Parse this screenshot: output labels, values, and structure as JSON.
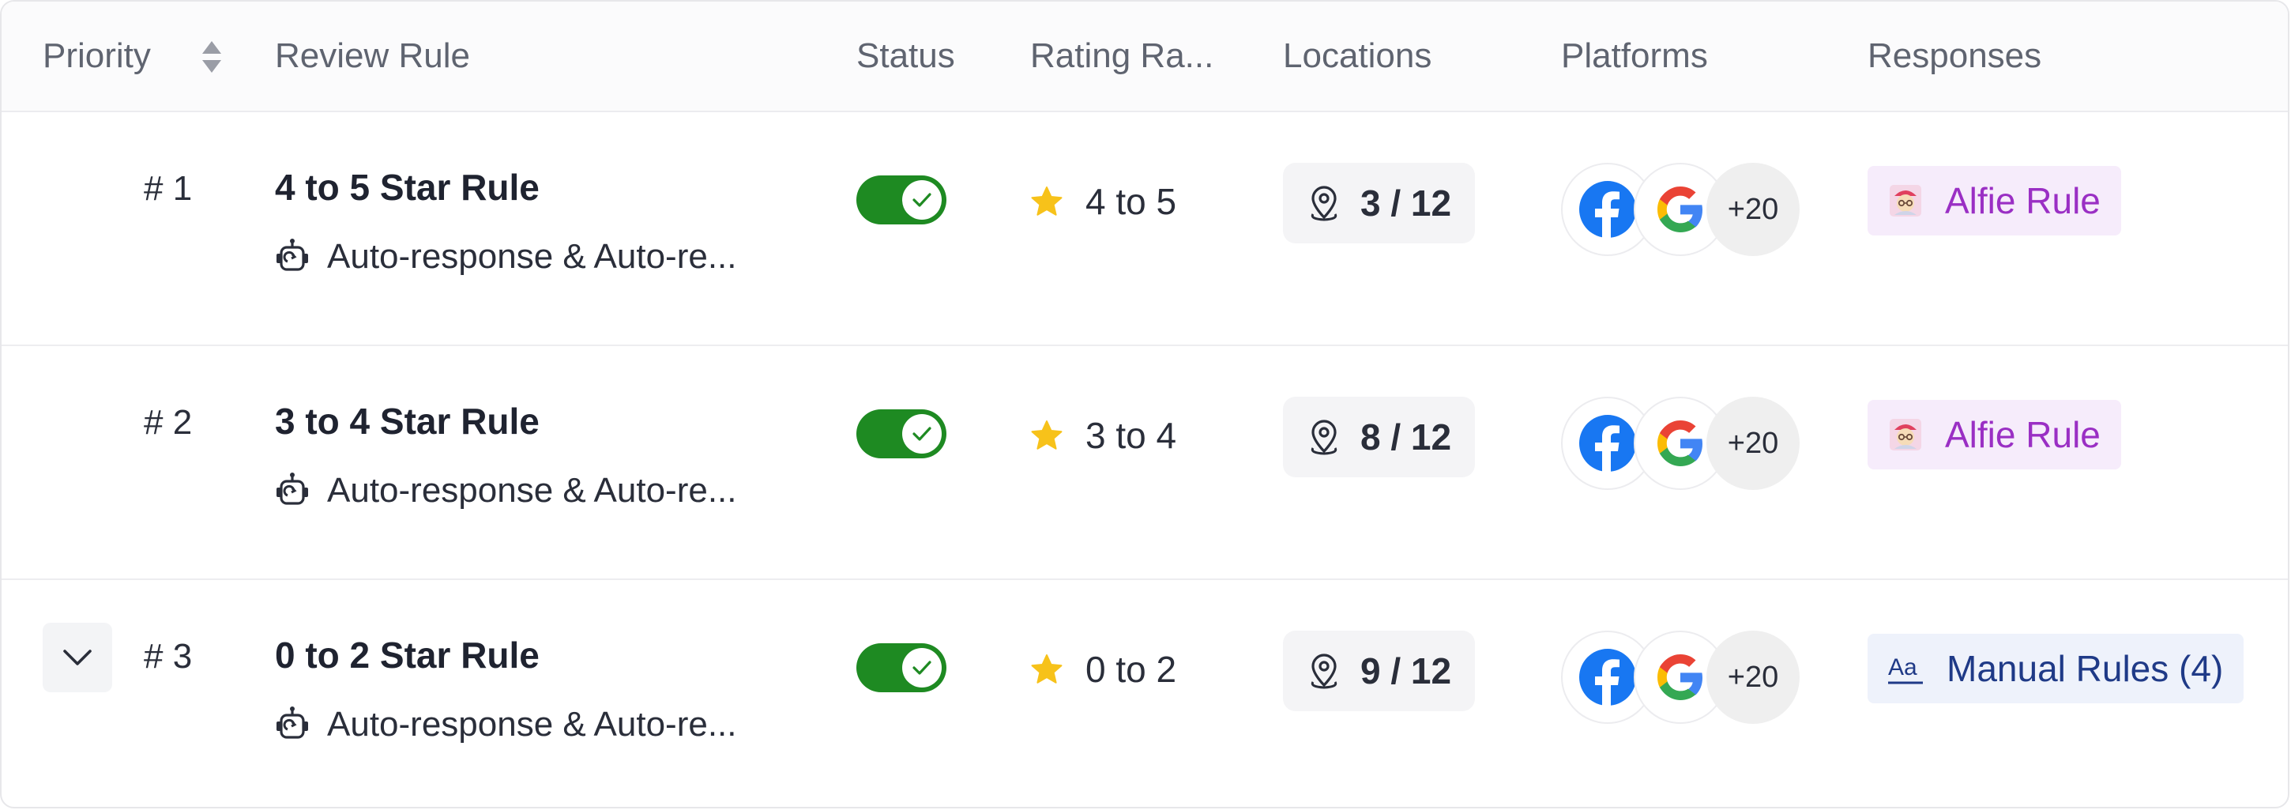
{
  "header": {
    "priority": "Priority",
    "review_rule": "Review Rule",
    "status": "Status",
    "rating_range": "Rating Ra...",
    "locations": "Locations",
    "platforms": "Platforms",
    "responses": "Responses"
  },
  "colors": {
    "toggle_on": "#1e8a22",
    "star": "#f7c21a",
    "alfie_bg": "#f6ecfb",
    "alfie_text": "#9a2fc4",
    "manual_bg": "#eef2fb",
    "manual_text": "#1f3a87"
  },
  "rows": [
    {
      "priority": "# 1",
      "name": "4 to 5 Star Rule",
      "subtitle": "Auto-response & Auto-re...",
      "status_on": true,
      "rating": "4 to 5",
      "locations": "3 / 12",
      "platform_icons": [
        "facebook-icon",
        "google-icon"
      ],
      "platforms_more": "+20",
      "response_icon": "alfie-avatar-icon",
      "response": "Alfie Rule"
    },
    {
      "priority": "# 2",
      "name": "3 to 4 Star Rule",
      "subtitle": "Auto-response & Auto-re...",
      "status_on": true,
      "rating": "3 to 4",
      "locations": "8 / 12",
      "platform_icons": [
        "facebook-icon",
        "google-icon"
      ],
      "platforms_more": "+20",
      "response_icon": "alfie-avatar-icon",
      "response": "Alfie Rule"
    },
    {
      "priority": "# 3",
      "name": "0 to 2 Star Rule",
      "subtitle": "Auto-response & Auto-re...",
      "status_on": true,
      "rating": "0 to 2",
      "locations": "9 / 12",
      "platform_icons": [
        "facebook-icon",
        "google-icon"
      ],
      "platforms_more": "+20",
      "response_icon": "text-format-icon",
      "response": "Manual Rules (4)"
    }
  ]
}
